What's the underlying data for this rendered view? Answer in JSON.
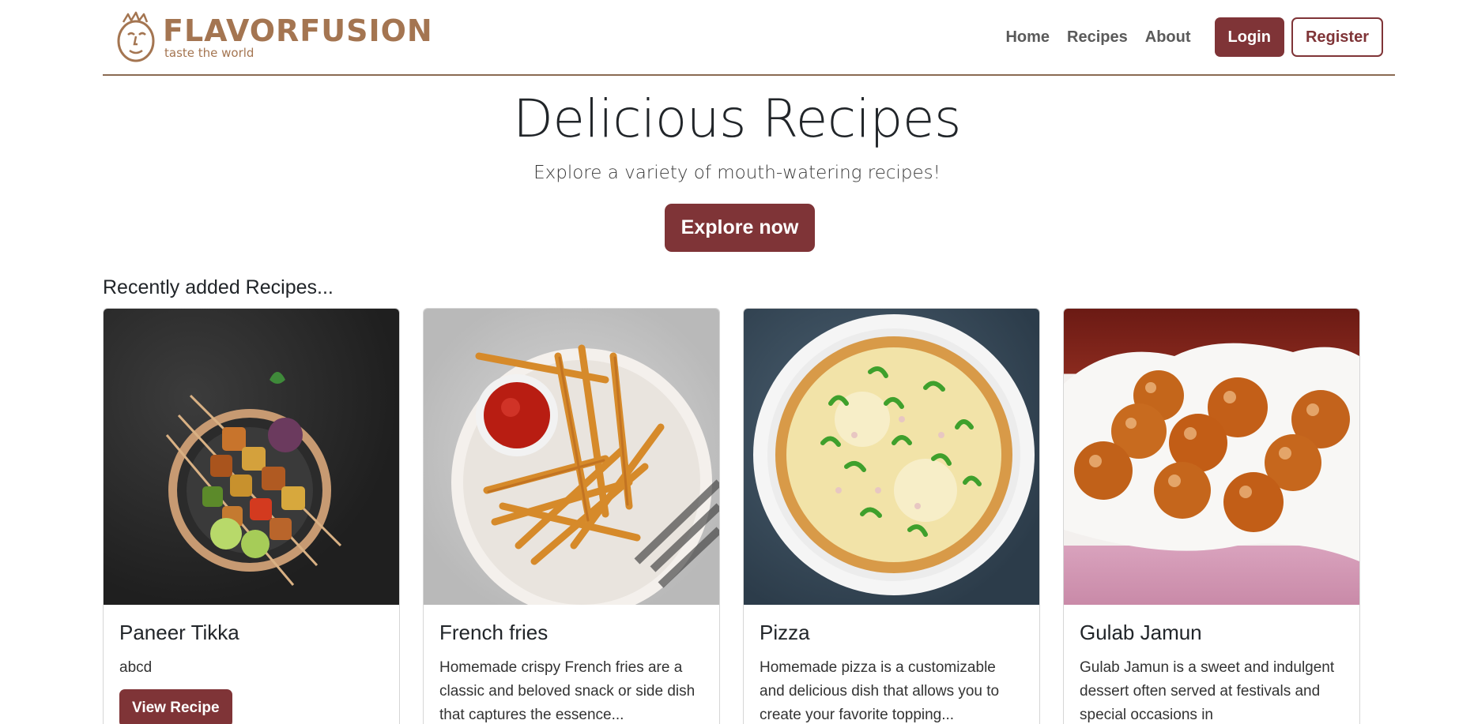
{
  "brand": {
    "name": "FLAVORFUSION",
    "tagline": "taste the world"
  },
  "nav": {
    "links": [
      "Home",
      "Recipes",
      "About"
    ],
    "login_label": "Login",
    "register_label": "Register"
  },
  "hero": {
    "title": "Delicious Recipes",
    "subtitle": "Explore a variety of mouth-watering recipes!",
    "cta_label": "Explore now"
  },
  "recent": {
    "heading": "Recently added Recipes...",
    "cards": [
      {
        "title": "Paneer Tikka",
        "text": "abcd",
        "button": "View Recipe",
        "image": "paneer-tikka-image"
      },
      {
        "title": "French fries",
        "text": "Homemade crispy French fries are a classic and beloved snack or side dish that captures the essence...",
        "image": "french-fries-image"
      },
      {
        "title": "Pizza",
        "text": "Homemade pizza is a customizable and delicious dish that allows you to create your favorite topping...",
        "image": "pizza-image"
      },
      {
        "title": "Gulab Jamun",
        "text": "Gulab Jamun is a sweet and indulgent dessert often served at festivals and special occasions in",
        "image": "gulab-jamun-image"
      }
    ]
  },
  "colors": {
    "primary": "#7f3437",
    "brand": "#a47551",
    "divider": "#8a6a52"
  }
}
